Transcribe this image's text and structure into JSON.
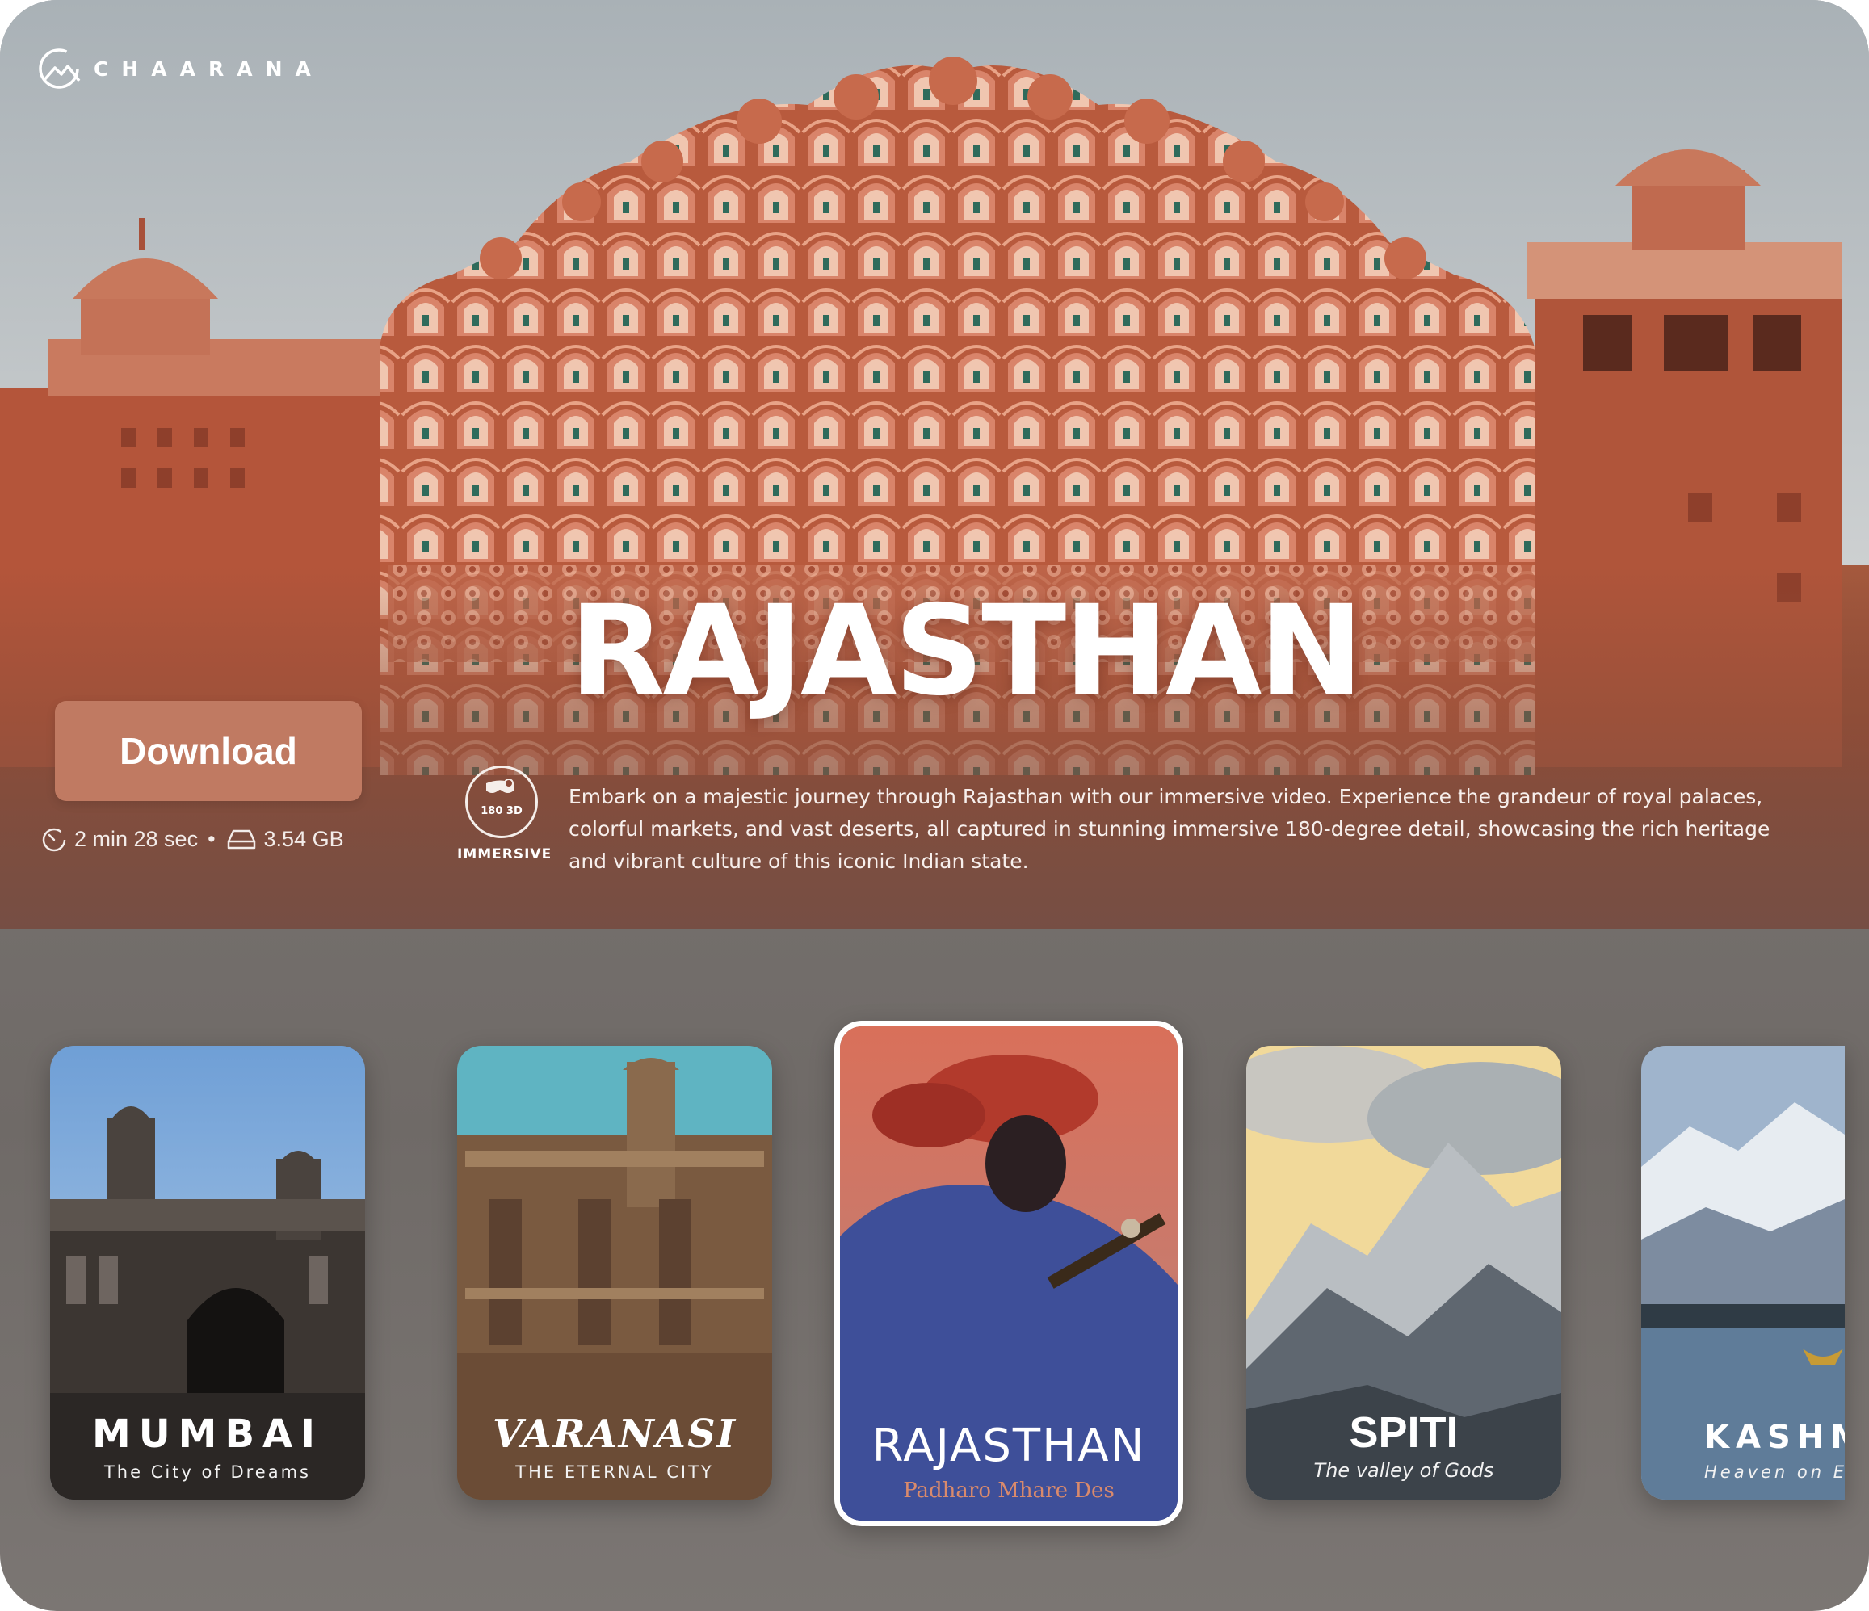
{
  "brand": {
    "name": "CHAARANA",
    "logo_icon": "mountain-circle-logo-icon"
  },
  "hero": {
    "title": "RAJASTHAN",
    "download_label": "Download",
    "duration": "2 min 28 sec",
    "separator": "•",
    "size": "3.54 GB",
    "immersive_badge": "180 3D",
    "immersive_label": "IMMERSIVE",
    "description": "Embark on a majestic journey through Rajasthan with our immersive video. Experience the grandeur of royal palaces, colorful markets, and vast deserts, all captured in stunning immersive 180-degree detail, showcasing the rich heritage and vibrant culture of this iconic Indian state."
  },
  "carousel": {
    "cards": [
      {
        "title": "MUMBAI",
        "subtitle": "The City of Dreams"
      },
      {
        "title": "VARANASI",
        "subtitle": "THE ETERNAL CITY"
      },
      {
        "title": "RAJASTHAN",
        "subtitle": "Padharo Mhare Des",
        "selected": true
      },
      {
        "title": "SPITI",
        "subtitle": "The valley of Gods"
      },
      {
        "title": "KASHM",
        "subtitle": "Heaven on E"
      }
    ]
  },
  "colors": {
    "download_button": "#c07a62",
    "rajasthan_subtitle": "#d98a6c",
    "selected_border": "#ffffff"
  }
}
